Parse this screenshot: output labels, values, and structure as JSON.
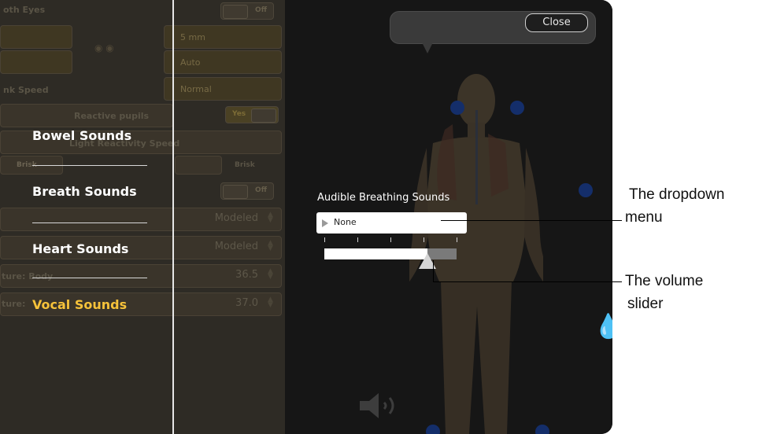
{
  "settings_panel": {
    "row1_label": "oth Eyes",
    "row1_toggle": "Off",
    "pupil_size": "5 mm",
    "pupil_mode": "Auto",
    "blink_label": "nk Speed",
    "blink_value": "Normal",
    "reactive_label": "Reactive pupils",
    "reactive_toggle": "Yes",
    "reactivity_label": "Light Reactivity Speed",
    "brisk_left": "Brisk",
    "brisk_right": "Brisk",
    "toggle_off_2": "Off",
    "modeled_1": "Modeled",
    "modeled_2": "Modeled",
    "temp_body_label": "ture: Body",
    "temp_body_value": "36.5",
    "temp_core_label": "ture:",
    "temp_core_value": "37.0"
  },
  "sounds_menu": {
    "items": [
      {
        "label": "Bowel Sounds"
      },
      {
        "label": "Breath Sounds"
      },
      {
        "label": ""
      },
      {
        "label": "Heart Sounds"
      },
      {
        "label": "Vocal Sounds"
      }
    ],
    "active_index": 4,
    "active_color": "#f6c23a"
  },
  "close_button": {
    "label": "Close"
  },
  "breathing": {
    "label": "Audible Breathing Sounds",
    "dropdown_value": "None",
    "volume_fraction": 0.78
  },
  "icons": {
    "dropdown_arrow": "triangle-right-icon",
    "speaker": "speaker-icon",
    "drop": "water-drop-icon"
  },
  "annotations": {
    "dropdown_callout_line1": "The dropdown",
    "dropdown_callout_line2": "menu",
    "slider_callout_line1": "The volume",
    "slider_callout_line2": "slider"
  }
}
